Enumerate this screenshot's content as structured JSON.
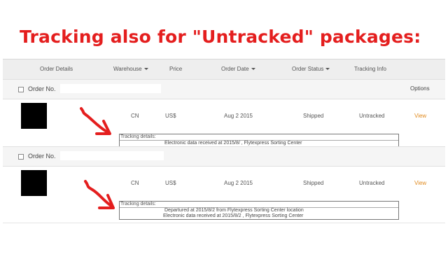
{
  "headline": "Tracking also for \"Untracked\" packages:",
  "header": {
    "order_details": "Order Details",
    "warehouse": "Warehouse",
    "price": "Price",
    "order_date": "Order Date",
    "order_status": "Order Status",
    "tracking_info": "Tracking Info"
  },
  "orders": [
    {
      "order_label": "Order No.",
      "options": "Options",
      "warehouse": "CN",
      "price": "US$",
      "date": "Aug 2   2015",
      "status": "Shipped",
      "tracking": "Untracked",
      "view": "View",
      "tracking_details_label": "Tracking details:",
      "tracking_lines": [
        "Electronic data received at 2015/8/                    , Flytexpress Sorting Center"
      ]
    },
    {
      "order_label": "Order No.",
      "warehouse": "CN",
      "price": "US$",
      "date": "Aug 2   2015",
      "status": "Shipped",
      "tracking": "Untracked",
      "view": "View",
      "tracking_details_label": "Tracking details:",
      "tracking_lines": [
        "Departured at 2015/8/2                    from Flytexpress Sorting Center location",
        "Electronic data received at 2015/8/2                    , Flytexpress Sorting Center"
      ]
    }
  ],
  "colors": {
    "headline": "#e41e1e",
    "view_link": "#e08a1e",
    "header_bg": "#eeeeee",
    "order_row_bg": "#f5f5f5"
  }
}
